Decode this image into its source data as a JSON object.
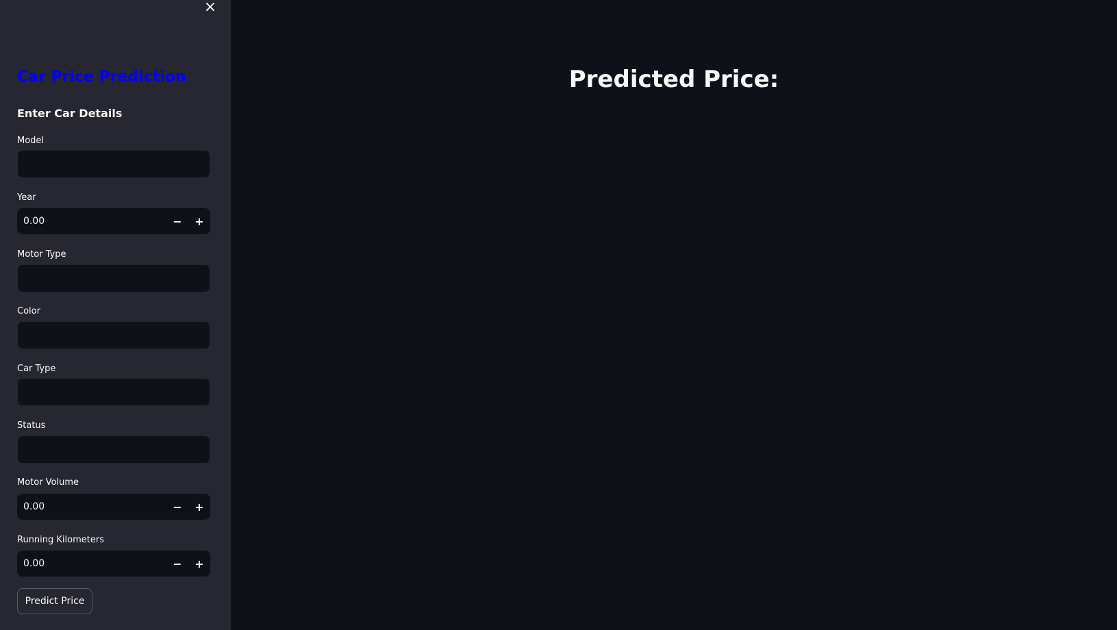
{
  "sidebar": {
    "close_icon": "×",
    "title": "Car Price Prediction",
    "subtitle": "Enter Car Details",
    "fields": {
      "model": {
        "label": "Model",
        "value": ""
      },
      "year": {
        "label": "Year",
        "value": "0.00"
      },
      "motor_type": {
        "label": "Motor Type",
        "value": ""
      },
      "color": {
        "label": "Color",
        "value": ""
      },
      "car_type": {
        "label": "Car Type",
        "value": ""
      },
      "status": {
        "label": "Status",
        "value": ""
      },
      "motor_volume": {
        "label": "Motor Volume",
        "value": "0.00"
      },
      "running_km": {
        "label": "Running Kilometers",
        "value": "0.00"
      }
    },
    "stepper": {
      "minus": "−",
      "plus": "+"
    },
    "predict_button": "Predict Price"
  },
  "main": {
    "heading": "Predicted Price:"
  },
  "colors": {
    "background": "#0e1117",
    "sidebar": "#262730",
    "title": "#0000ff",
    "text": "#fafafa"
  }
}
